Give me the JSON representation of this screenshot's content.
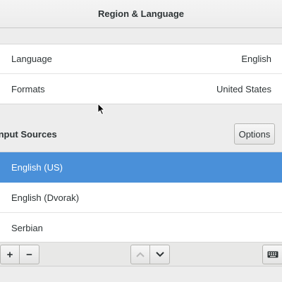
{
  "window": {
    "title": "Region & Language"
  },
  "settings": [
    {
      "label": "Language",
      "value": "English"
    },
    {
      "label": "Formats",
      "value": "United States"
    }
  ],
  "input_sources": {
    "header": "Input Sources",
    "options_label": "Options",
    "items": [
      {
        "label": "English (US)",
        "selected": true
      },
      {
        "label": "English (Dvorak)",
        "selected": false
      },
      {
        "label": "Serbian",
        "selected": false
      }
    ]
  },
  "toolbar": {
    "add_label": "+",
    "remove_label": "−",
    "up_icon": "chevron-up-icon",
    "down_icon": "chevron-down-icon",
    "keyboard_icon": "keyboard-icon"
  },
  "colors": {
    "selection": "#4a90d9",
    "background": "#ededed"
  }
}
